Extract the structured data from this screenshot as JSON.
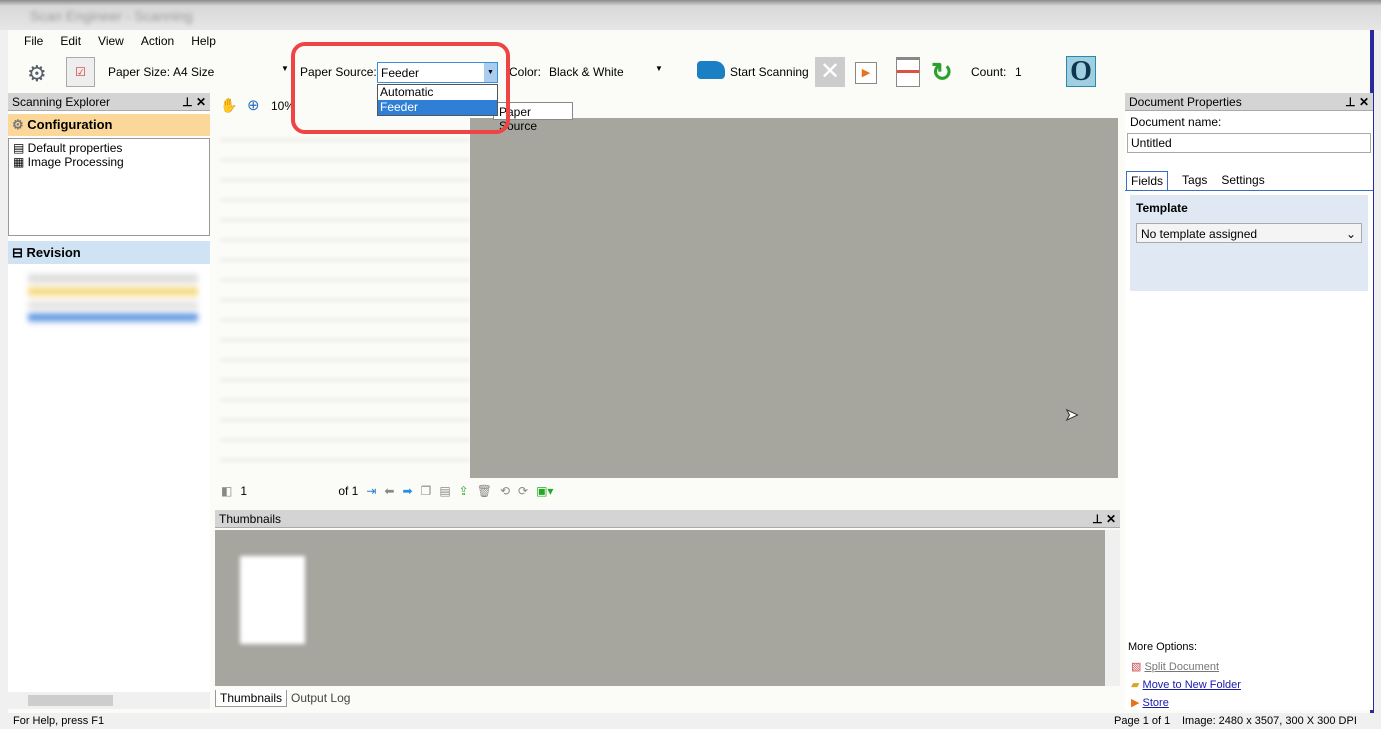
{
  "window": {
    "title": "Scan Engineer - Scanning"
  },
  "menu": [
    "File",
    "Edit",
    "View",
    "Action",
    "Help"
  ],
  "toolbar": {
    "paper_size_label": "Paper Size:",
    "paper_size_value": "A4 Size",
    "paper_source_label": "Paper Source:",
    "paper_source_value": "Feeder",
    "paper_source_options": [
      "Automatic",
      "Feeder"
    ],
    "tooltip": "Paper Source",
    "color_label": "Color:",
    "color_value": "Black & White",
    "start_scanning": "Start Scanning",
    "count_label": "Count:",
    "count_value": "1"
  },
  "scanning_explorer": {
    "title": "Scanning Explorer",
    "configuration": "Configuration",
    "items": [
      "Default properties",
      "Image Processing"
    ],
    "revision": "Revision"
  },
  "viewer": {
    "zoom": "10%",
    "page_input": "1",
    "page_of": "of 1"
  },
  "thumbnails": {
    "title": "Thumbnails",
    "tabs": [
      "Thumbnails",
      "Output Log"
    ]
  },
  "doc_props": {
    "title": "Document Properties",
    "name_label": "Document name:",
    "name_value": "Untitled",
    "tabs": [
      "Fields",
      "Tags",
      "Settings"
    ],
    "template_label": "Template",
    "template_value": "No template assigned",
    "more_options": "More Options:",
    "links": [
      "Split Document",
      "Move to New Folder",
      "Store"
    ]
  },
  "status": {
    "help": "For Help, press F1",
    "page": "Page 1 of 1",
    "image": "Image: 2480 x 3507, 300 X 300 DPI"
  },
  "colors": {
    "highlight": "#ef4444",
    "selection": "#3b8edc",
    "config_bg": "#fbd79a",
    "revision_bg": "#cfe3f5",
    "viewer_gray": "#a6a69e"
  }
}
